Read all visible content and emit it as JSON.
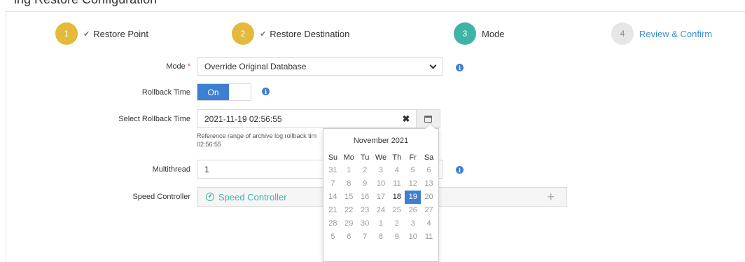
{
  "header": {
    "clipped_title": "ing Restore Configuration"
  },
  "steps": [
    {
      "number": "1",
      "label": "Restore Point",
      "state": "done"
    },
    {
      "number": "2",
      "label": "Restore Destination",
      "state": "done"
    },
    {
      "number": "3",
      "label": "Mode",
      "state": "active"
    },
    {
      "number": "4",
      "label": "Review & Confirm",
      "state": "todo"
    }
  ],
  "form": {
    "mode_label": "Mode",
    "required_mark": "*",
    "mode_value": "Override Original Database",
    "rollback_label": "Rollback Time",
    "rollback_toggle": "On",
    "select_rollback_label": "Select Rollback Time",
    "rollback_value": "2021-11-19 02:56:55",
    "clear_glyph": "✖",
    "hint_text": "Reference range of archive log rollback tim\n02:56:55",
    "multithread_label": "Multithread",
    "multithread_value": "1",
    "speed_label": "Speed Controller",
    "speed_button": "Speed Controller",
    "speed_add_glyph": "+",
    "info_glyph": "i"
  },
  "calendar": {
    "title": "November 2021",
    "days_of_week": [
      "Su",
      "Mo",
      "Tu",
      "We",
      "Th",
      "Fr",
      "Sa"
    ],
    "weeks": [
      [
        "31",
        "1",
        "2",
        "3",
        "4",
        "5",
        "6"
      ],
      [
        "7",
        "8",
        "9",
        "10",
        "11",
        "12",
        "13"
      ],
      [
        "14",
        "15",
        "16",
        "17",
        "18",
        "19",
        "20"
      ],
      [
        "21",
        "22",
        "23",
        "24",
        "25",
        "26",
        "27"
      ],
      [
        "28",
        "29",
        "30",
        "1",
        "2",
        "3",
        "4"
      ],
      [
        "5",
        "6",
        "7",
        "8",
        "9",
        "10",
        "11"
      ]
    ],
    "today": "18",
    "selected": "19"
  },
  "colors": {
    "step_done": "#e4b93c",
    "step_active": "#40b3a8",
    "step_todo": "#e6e6e6",
    "accent": "#3d7fd0",
    "link": "#3d8fd6"
  }
}
